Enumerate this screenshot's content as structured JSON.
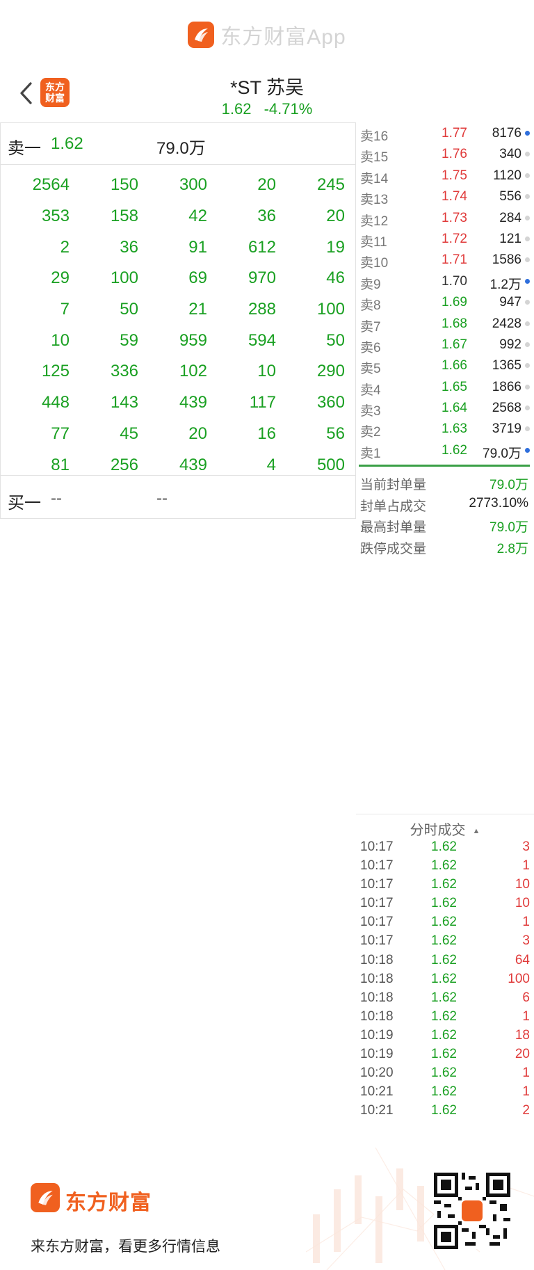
{
  "brand": {
    "title": "东方财富App"
  },
  "header": {
    "app_logo_text": "东方\n财富",
    "stock_name": "*ST 苏吴",
    "price": "1.62",
    "change_pct": "-4.71%"
  },
  "left": {
    "ask_label": "卖一",
    "ask_price": "1.62",
    "ask_volume": "79.0万",
    "queue": [
      [
        "2564",
        "150",
        "300",
        "20",
        "245"
      ],
      [
        "353",
        "158",
        "42",
        "36",
        "20"
      ],
      [
        "2",
        "36",
        "91",
        "612",
        "19"
      ],
      [
        "29",
        "100",
        "69",
        "970",
        "46"
      ],
      [
        "7",
        "50",
        "21",
        "288",
        "100"
      ],
      [
        "10",
        "59",
        "959",
        "594",
        "50"
      ],
      [
        "125",
        "336",
        "102",
        "10",
        "290"
      ],
      [
        "448",
        "143",
        "439",
        "117",
        "360"
      ],
      [
        "77",
        "45",
        "20",
        "16",
        "56"
      ],
      [
        "81",
        "256",
        "439",
        "4",
        "500"
      ]
    ],
    "bid_label": "买一",
    "bid_price": "--",
    "bid_volume": "--"
  },
  "orderbook": [
    {
      "label": "卖16",
      "price": "1.77",
      "volume": "8176",
      "color": "red",
      "dot": "blue"
    },
    {
      "label": "卖15",
      "price": "1.76",
      "volume": "340",
      "color": "red",
      "dot": "gray"
    },
    {
      "label": "卖14",
      "price": "1.75",
      "volume": "1120",
      "color": "red",
      "dot": "gray"
    },
    {
      "label": "卖13",
      "price": "1.74",
      "volume": "556",
      "color": "red",
      "dot": "gray"
    },
    {
      "label": "卖12",
      "price": "1.73",
      "volume": "284",
      "color": "red",
      "dot": "gray"
    },
    {
      "label": "卖11",
      "price": "1.72",
      "volume": "121",
      "color": "red",
      "dot": "gray"
    },
    {
      "label": "卖10",
      "price": "1.71",
      "volume": "1586",
      "color": "red",
      "dot": "gray"
    },
    {
      "label": "卖9",
      "price": "1.70",
      "volume": "1.2万",
      "color": "gray",
      "dot": "blue"
    },
    {
      "label": "卖8",
      "price": "1.69",
      "volume": "947",
      "color": "green",
      "dot": "gray"
    },
    {
      "label": "卖7",
      "price": "1.68",
      "volume": "2428",
      "color": "green",
      "dot": "gray"
    },
    {
      "label": "卖6",
      "price": "1.67",
      "volume": "992",
      "color": "green",
      "dot": "gray"
    },
    {
      "label": "卖5",
      "price": "1.66",
      "volume": "1365",
      "color": "green",
      "dot": "gray"
    },
    {
      "label": "卖4",
      "price": "1.65",
      "volume": "1866",
      "color": "green",
      "dot": "gray"
    },
    {
      "label": "卖3",
      "price": "1.64",
      "volume": "2568",
      "color": "green",
      "dot": "gray"
    },
    {
      "label": "卖2",
      "price": "1.63",
      "volume": "3719",
      "color": "green",
      "dot": "gray"
    },
    {
      "label": "卖1",
      "price": "1.62",
      "volume": "79.0万",
      "color": "green",
      "dot": "blue"
    }
  ],
  "seal_stats": [
    {
      "label": "当前封单量",
      "value": "79.0万",
      "color": "green"
    },
    {
      "label": "封单占成交",
      "value": "2773.10%",
      "color": "dark"
    },
    {
      "label": "最高封单量",
      "value": "79.0万",
      "color": "green"
    },
    {
      "label": "跌停成交量",
      "value": "2.8万",
      "color": "green"
    }
  ],
  "ticks": {
    "title": "分时成交",
    "rows": [
      {
        "time": "10:17",
        "price": "1.62",
        "volume": "3"
      },
      {
        "time": "10:17",
        "price": "1.62",
        "volume": "1"
      },
      {
        "time": "10:17",
        "price": "1.62",
        "volume": "10"
      },
      {
        "time": "10:17",
        "price": "1.62",
        "volume": "10"
      },
      {
        "time": "10:17",
        "price": "1.62",
        "volume": "1"
      },
      {
        "time": "10:17",
        "price": "1.62",
        "volume": "3"
      },
      {
        "time": "10:18",
        "price": "1.62",
        "volume": "64"
      },
      {
        "time": "10:18",
        "price": "1.62",
        "volume": "100"
      },
      {
        "time": "10:18",
        "price": "1.62",
        "volume": "6"
      },
      {
        "time": "10:18",
        "price": "1.62",
        "volume": "1"
      },
      {
        "time": "10:19",
        "price": "1.62",
        "volume": "18"
      },
      {
        "time": "10:19",
        "price": "1.62",
        "volume": "20"
      },
      {
        "time": "10:20",
        "price": "1.62",
        "volume": "1"
      },
      {
        "time": "10:21",
        "price": "1.62",
        "volume": "1"
      },
      {
        "time": "10:21",
        "price": "1.62",
        "volume": "2"
      }
    ]
  },
  "footer": {
    "brand": "东方财富",
    "slogan": "来东方财富，看更多行情信息"
  },
  "colors": {
    "brand_orange": "#f0601f",
    "up_red": "#e03a3a",
    "down_green": "#1aa022",
    "dot_blue": "#2f6fdc"
  },
  "icons": {
    "back": "chevron-left-icon",
    "logo": "eastmoney-logo-icon",
    "sort": "caret-up-icon",
    "qr": "qr-code-icon"
  }
}
